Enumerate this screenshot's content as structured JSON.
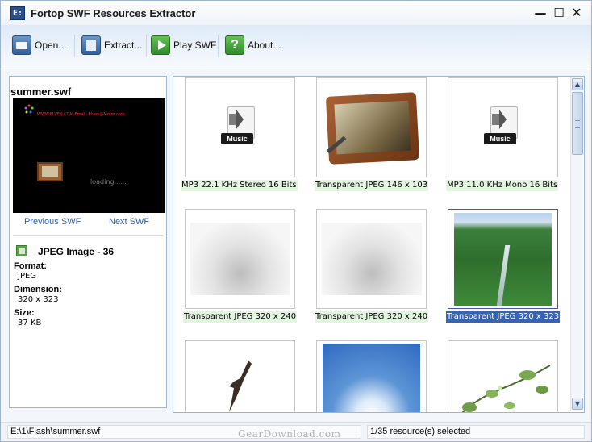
{
  "window": {
    "title": "Fortop SWF Resources Extractor",
    "app_icon_text": "E:",
    "controls": {
      "minimize": "—",
      "maximize": "☐",
      "close": "✕"
    }
  },
  "toolbar": {
    "open_label": "Open...",
    "extract_label": "Extract...",
    "play_label": "Play SWF",
    "about_label": "About...",
    "about_icon_glyph": "?"
  },
  "left_panel": {
    "swf_name": "summer.swf",
    "preview": {
      "red_text": "WWW.ELVEN.COM     Email: Elven@Mmm.com",
      "loading_text": "loading......"
    },
    "prev_label": "Previous SWF",
    "next_label": "Next SWF",
    "resource_title": "JPEG Image - 36",
    "format_label": "Format:",
    "format_value": "JPEG",
    "dimension_label": "Dimension:",
    "dimension_value": "320 x 323",
    "size_label": "Size:",
    "size_value": "37 KB"
  },
  "grid": {
    "items": [
      {
        "caption": "MP3 22.1 KHz  Stereo  16 Bits",
        "type": "music",
        "icon_text": "Music"
      },
      {
        "caption": "Transparent JPEG 146 x 103",
        "type": "frame"
      },
      {
        "caption": "MP3 11.0 KHz  Mono  16 Bits",
        "type": "music",
        "icon_text": "Music"
      },
      {
        "caption": "Transparent JPEG 320 x 240",
        "type": "clouds"
      },
      {
        "caption": "Transparent JPEG 320 x 240",
        "type": "clouds"
      },
      {
        "caption": "Transparent JPEG 320 x 323",
        "type": "forest",
        "selected": true
      },
      {
        "caption": "",
        "type": "bird"
      },
      {
        "caption": "",
        "type": "blue-sky"
      },
      {
        "caption": "",
        "type": "vine"
      }
    ]
  },
  "scrollbar": {
    "up_glyph": "▲",
    "down_glyph": "▼"
  },
  "status": {
    "path": "E:\\1\\Flash\\summer.swf",
    "count": "1/35 resource(s) selected"
  },
  "watermark": "GearDownload.com",
  "colors": {
    "accent": "#3563b5",
    "caption_bg": "#e3f5e1",
    "link": "#2b5ea8",
    "border": "#9bb4d2"
  }
}
